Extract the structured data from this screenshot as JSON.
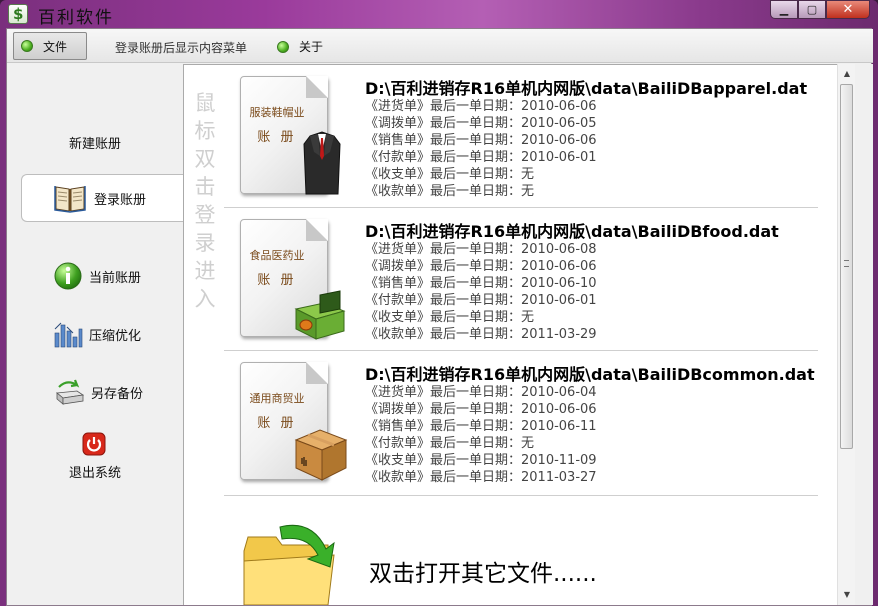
{
  "window": {
    "title": "百利软件",
    "app_icon_glyph": "$"
  },
  "menubar": {
    "file_label": "文件",
    "hint": "登录账册后显示内容菜单",
    "about_label": "关于"
  },
  "sidebar": {
    "items": [
      {
        "label": "新建账册",
        "icon": "none"
      },
      {
        "label": "登录账册",
        "icon": "book-icon",
        "active": true
      },
      {
        "label": "当前账册",
        "icon": "info-icon"
      },
      {
        "label": "压缩优化",
        "icon": "bars-icon"
      },
      {
        "label": "另存备份",
        "icon": "backup-icon"
      },
      {
        "label": "退出系统",
        "icon": "power-icon"
      }
    ]
  },
  "main": {
    "vertical_hint": "鼠标双击登录进入",
    "books": [
      {
        "path": "D:\\百利进销存R16单机内网版\\data\\BailiDBapparel.dat",
        "doc_title": "服装鞋帽业",
        "doc_sub": "账 册",
        "pic": "suit-icon",
        "lines": [
          "《进货单》最后一单日期：2010-06-06",
          "《调拨单》最后一单日期：2010-06-05",
          "《销售单》最后一单日期：2010-06-06",
          "《付款单》最后一单日期：2010-06-01",
          "《收支单》最后一单日期：无",
          "《收款单》最后一单日期：无"
        ]
      },
      {
        "path": "D:\\百利进销存R16单机内网版\\data\\BailiDBfood.dat",
        "doc_title": "食品医药业",
        "doc_sub": "账 册",
        "pic": "giftbox-icon",
        "lines": [
          "《进货单》最后一单日期：2010-06-08",
          "《调拨单》最后一单日期：2010-06-06",
          "《销售单》最后一单日期：2010-06-10",
          "《付款单》最后一单日期：2010-06-01",
          "《收支单》最后一单日期：无",
          "《收款单》最后一单日期：2011-03-29"
        ]
      },
      {
        "path": "D:\\百利进销存R16单机内网版\\data\\BailiDBcommon.dat",
        "doc_title": "通用商贸业",
        "doc_sub": "账 册",
        "pic": "cardboard-box-icon",
        "lines": [
          "《进货单》最后一单日期：2010-06-04",
          "《调拨单》最后一单日期：2010-06-06",
          "《销售单》最后一单日期：2010-06-11",
          "《付款单》最后一单日期：无",
          "《收支单》最后一单日期：2010-11-09",
          "《收款单》最后一单日期：2011-03-27"
        ]
      }
    ],
    "open_other_label": "双击打开其它文件......"
  },
  "colors": {
    "title_gradient": "#9a3a9b",
    "active_dot": "#4caf20",
    "close_button": "#c0301e"
  }
}
